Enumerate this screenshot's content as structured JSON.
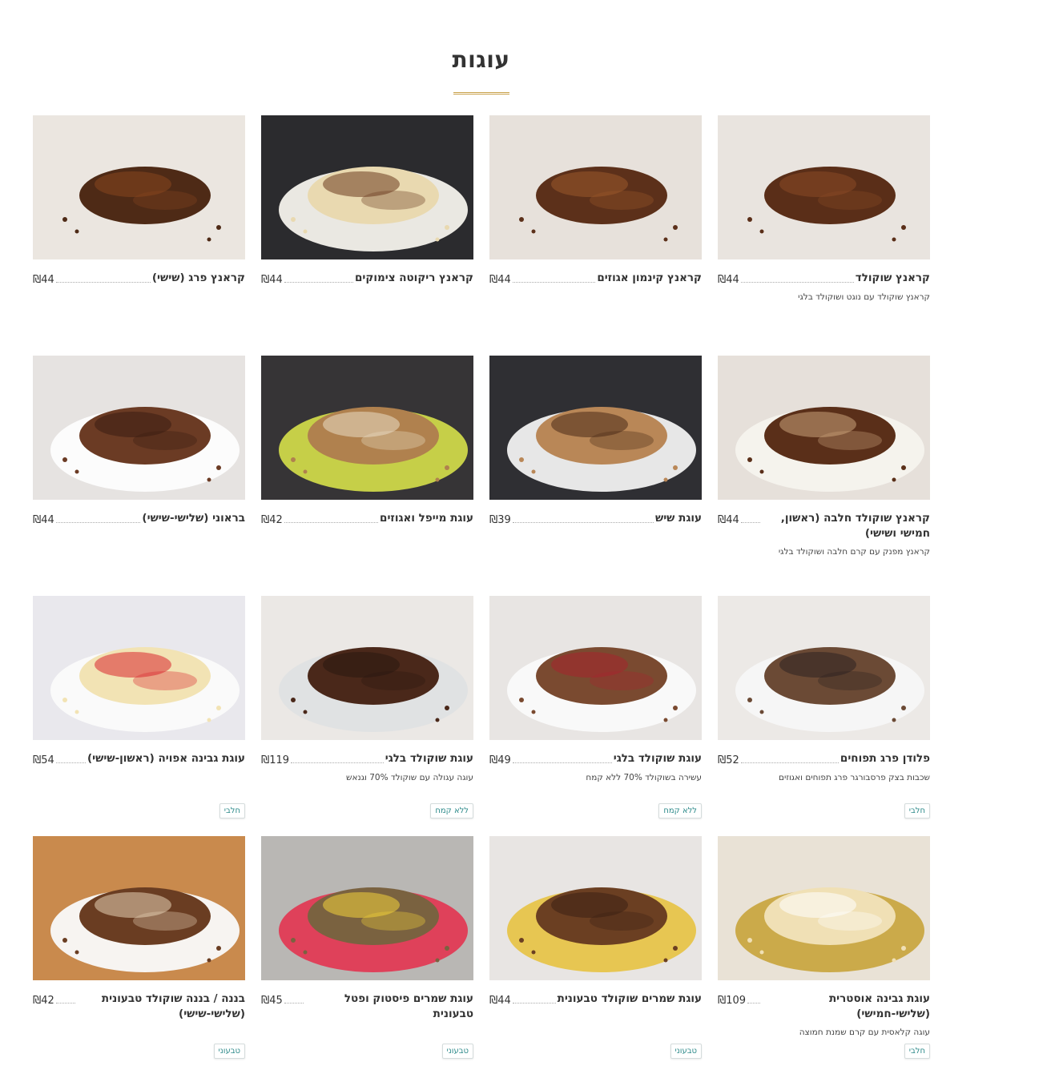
{
  "page": {
    "title": "עוגות"
  },
  "colors": {
    "accent_gold": "#c9a14a",
    "badge_teal": "#2e8b8b"
  },
  "products": [
    {
      "name": "קראנץ שוקולד",
      "price": "₪44",
      "description": "קראנץ שוקולד עם נוגט ושוקולד בלגי",
      "badge": "",
      "image": "chocolate-krantz"
    },
    {
      "name": "קראנץ קינמון אגוזים",
      "price": "₪44",
      "description": "",
      "badge": "",
      "image": "cinnamon-walnut-krantz"
    },
    {
      "name": "קראנץ ריקוטה צימוקים",
      "price": "₪44",
      "description": "",
      "badge": "",
      "image": "ricotta-raisin-krantz"
    },
    {
      "name": "קראנץ פרג (שישי)",
      "price": "₪44",
      "description": "",
      "badge": "",
      "image": "poppy-krantz"
    },
    {
      "name": "קראנץ שוקולד חלבה (ראשון, חמישי ושישי)",
      "price": "₪44",
      "description": "קראנץ מפנק עם קרם חלבה ושוקולד בלגי",
      "badge": "",
      "image": "halva-krantz"
    },
    {
      "name": "עוגת שיש",
      "price": "₪39",
      "description": "",
      "badge": "",
      "image": "marble-cake"
    },
    {
      "name": "עוגת מייפל ואגוזים",
      "price": "₪42",
      "description": "",
      "badge": "",
      "image": "maple-walnut-cake"
    },
    {
      "name": "בראוני (שלישי-שישי)",
      "price": "₪44",
      "description": "",
      "badge": "",
      "image": "brownie"
    },
    {
      "name": "פלודן פרג תפוחים",
      "price": "₪52",
      "description": "שכבות בצק פרסבורגר פרג תפוחים ואגוזים",
      "badge": "חלבי",
      "image": "flodni"
    },
    {
      "name": "עוגת שוקולד בלגי",
      "price": "₪49",
      "description": "עשירה בשוקולד 70% ללא קמח",
      "badge": "ללא קמח",
      "image": "belgian-chocolate-loaf"
    },
    {
      "name": "עוגת שוקולד בלגי",
      "price": "₪119",
      "description": "עוגה עגולה עם שוקולד 70% וגנאש",
      "badge": "ללא קמח",
      "image": "belgian-chocolate-round"
    },
    {
      "name": "עוגת גבינה אפויה (ראשון-שישי)",
      "price": "₪54",
      "description": "",
      "badge": "חלבי",
      "image": "baked-cheesecake"
    },
    {
      "name": "עוגת גבינה אוסטרית (שלישי-חמישי)",
      "price": "₪109",
      "description": "עוגה קלאסית עם קרם שמנת חמוצה",
      "badge": "חלבי",
      "image": "austrian-cheesecake"
    },
    {
      "name": "עוגת שמרים שוקולד טבעונית",
      "price": "₪44",
      "description": "",
      "badge": "טבעוני",
      "image": "vegan-yeast-chocolate"
    },
    {
      "name": "עוגת שמרים פיסטוק ופטל טבעונית",
      "price": "₪45",
      "description": "",
      "badge": "טבעוני",
      "image": "vegan-pistachio-raspberry"
    },
    {
      "name": "בננה / בננה שוקולד טבעונית (שלישי-שישי)",
      "price": "₪42",
      "description": "",
      "badge": "טבעוני",
      "image": "vegan-banana"
    }
  ]
}
